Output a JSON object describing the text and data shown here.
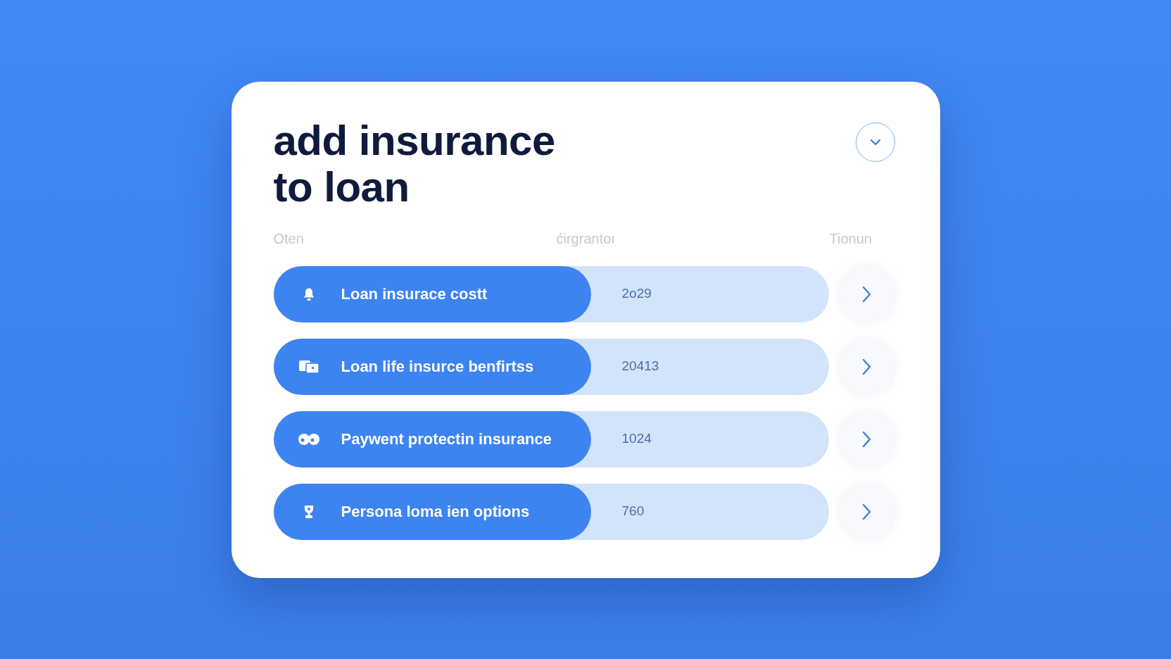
{
  "card": {
    "title": "add insurance to loan"
  },
  "columns": [
    "Oten",
    "ćirgrantoı",
    "Tionun"
  ],
  "rows": [
    {
      "label": "Loan insurace costt",
      "value": "2o29"
    },
    {
      "label": "Loan life insurce benfirtss",
      "value": "20413"
    },
    {
      "label": "Paywent protectin insurance",
      "value": "1024"
    },
    {
      "label": "Persona loma ien options",
      "value": "760"
    }
  ]
}
